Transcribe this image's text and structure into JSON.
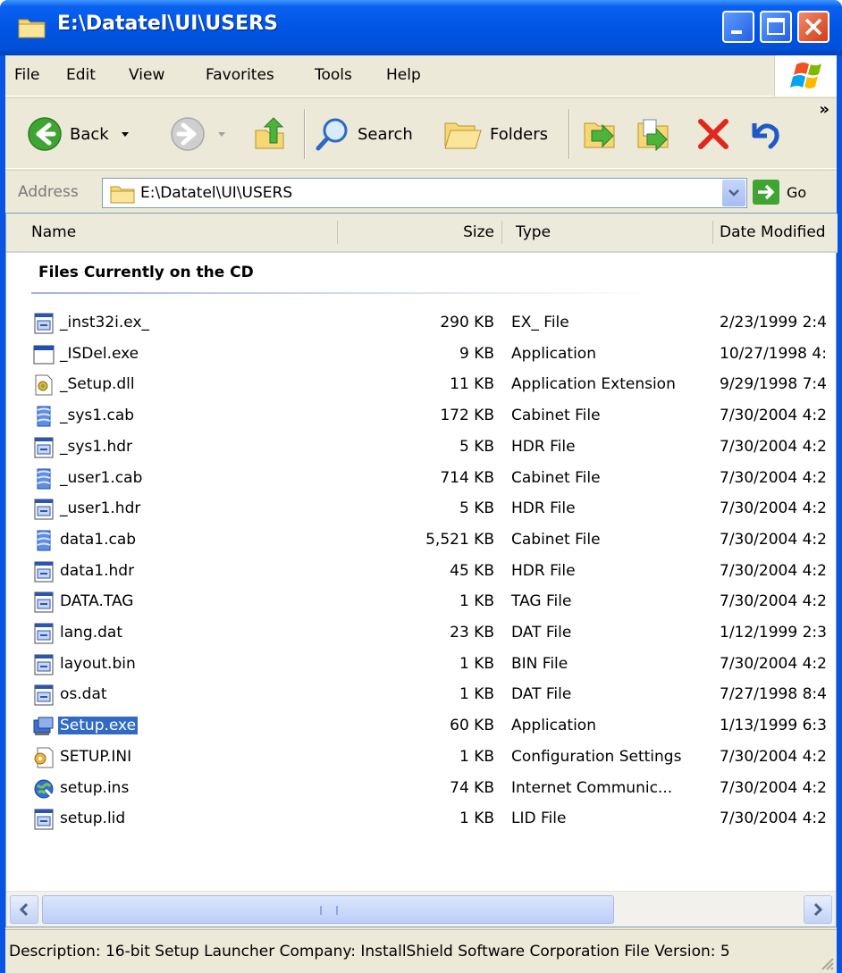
{
  "window": {
    "title": "E:\\Datatel\\UI\\USERS",
    "controls": {
      "minimize": "minimize",
      "maximize": "maximize",
      "close": "close"
    }
  },
  "menu": [
    {
      "label": "File"
    },
    {
      "label": "Edit"
    },
    {
      "label": "View"
    },
    {
      "label": "Favorites"
    },
    {
      "label": "Tools"
    },
    {
      "label": "Help"
    }
  ],
  "toolbar": {
    "back_label": "Back",
    "search_label": "Search",
    "folders_label": "Folders",
    "chevron": "»"
  },
  "address": {
    "label": "Address",
    "value": "E:\\Datatel\\UI\\USERS",
    "go_label": "Go"
  },
  "columns": {
    "name": "Name",
    "size": "Size",
    "type": "Type",
    "date": "Date Modified"
  },
  "group_title": "Files Currently on the CD",
  "files": [
    {
      "name": "_inst32i.ex_",
      "size": "290 KB",
      "type": "EX_ File",
      "date": "2/23/1999 2:4",
      "icon": "generic-file-icon"
    },
    {
      "name": "_ISDel.exe",
      "size": "9 KB",
      "type": "Application",
      "date": "10/27/1998 4:",
      "icon": "application-icon"
    },
    {
      "name": "_Setup.dll",
      "size": "11 KB",
      "type": "Application Extension",
      "date": "9/29/1998 7:4",
      "icon": "dll-icon"
    },
    {
      "name": "_sys1.cab",
      "size": "172 KB",
      "type": "Cabinet File",
      "date": "7/30/2004 4:2",
      "icon": "cabinet-icon"
    },
    {
      "name": "_sys1.hdr",
      "size": "5 KB",
      "type": "HDR File",
      "date": "7/30/2004 4:2",
      "icon": "generic-file-icon"
    },
    {
      "name": "_user1.cab",
      "size": "714 KB",
      "type": "Cabinet File",
      "date": "7/30/2004 4:2",
      "icon": "cabinet-icon"
    },
    {
      "name": "_user1.hdr",
      "size": "5 KB",
      "type": "HDR File",
      "date": "7/30/2004 4:2",
      "icon": "generic-file-icon"
    },
    {
      "name": "data1.cab",
      "size": "5,521 KB",
      "type": "Cabinet File",
      "date": "7/30/2004 4:2",
      "icon": "cabinet-icon"
    },
    {
      "name": "data1.hdr",
      "size": "45 KB",
      "type": "HDR File",
      "date": "7/30/2004 4:2",
      "icon": "generic-file-icon"
    },
    {
      "name": "DATA.TAG",
      "size": "1 KB",
      "type": "TAG File",
      "date": "7/30/2004 4:2",
      "icon": "generic-file-icon"
    },
    {
      "name": "lang.dat",
      "size": "23 KB",
      "type": "DAT File",
      "date": "1/12/1999 2:3",
      "icon": "generic-file-icon"
    },
    {
      "name": "layout.bin",
      "size": "1 KB",
      "type": "BIN File",
      "date": "7/30/2004 4:2",
      "icon": "generic-file-icon"
    },
    {
      "name": "os.dat",
      "size": "1 KB",
      "type": "DAT File",
      "date": "7/27/1998 8:4",
      "icon": "generic-file-icon"
    },
    {
      "name": "Setup.exe",
      "size": "60 KB",
      "type": "Application",
      "date": "1/13/1999 6:3",
      "icon": "setup-exe-icon",
      "selected": true
    },
    {
      "name": "SETUP.INI",
      "size": "1 KB",
      "type": "Configuration Settings",
      "date": "7/30/2004 4:2",
      "icon": "ini-settings-icon"
    },
    {
      "name": "setup.ins",
      "size": "74 KB",
      "type": "Internet Communic...",
      "date": "7/30/2004 4:2",
      "icon": "internet-icon"
    },
    {
      "name": "setup.lid",
      "size": "1 KB",
      "type": "LID File",
      "date": "7/30/2004 4:2",
      "icon": "generic-file-icon"
    }
  ],
  "status": "Description: 16-bit Setup Launcher Company: InstallShield Software Corporation File Version: 5"
}
